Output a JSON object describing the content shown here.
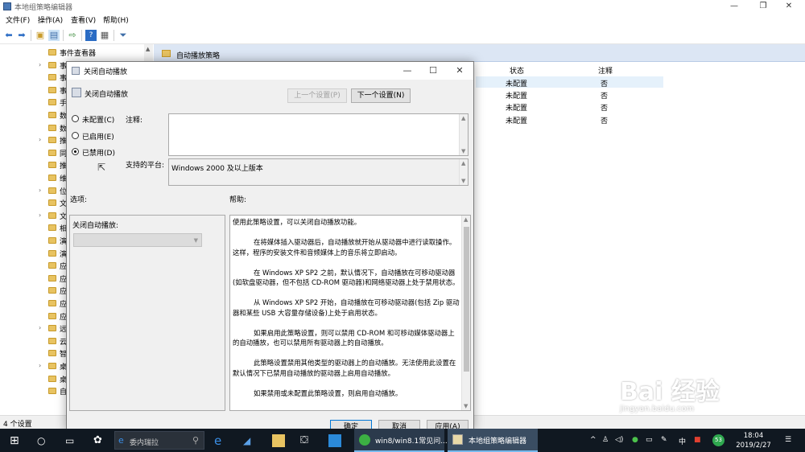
{
  "window": {
    "title": "本地组策略编辑器",
    "minimize": "—",
    "maximize": "❐",
    "close": "✕"
  },
  "menu": [
    "文件(F)",
    "操作(A)",
    "查看(V)",
    "帮助(H)"
  ],
  "tree": {
    "items": [
      {
        "label": "事件查看器",
        "expandable": false
      },
      {
        "label": "事",
        "expandable": true
      },
      {
        "label": "事",
        "expandable": false
      },
      {
        "label": "事",
        "expandable": false
      },
      {
        "label": "手",
        "expandable": false
      },
      {
        "label": "数",
        "expandable": false
      },
      {
        "label": "数",
        "expandable": false
      },
      {
        "label": "推",
        "expandable": true
      },
      {
        "label": "同",
        "expandable": false
      },
      {
        "label": "推",
        "expandable": false
      },
      {
        "label": "维",
        "expandable": false
      },
      {
        "label": "位",
        "expandable": true
      },
      {
        "label": "文",
        "expandable": false
      },
      {
        "label": "文",
        "expandable": true
      },
      {
        "label": "相",
        "expandable": false
      },
      {
        "label": "演",
        "expandable": false
      },
      {
        "label": "演",
        "expandable": false
      },
      {
        "label": "应",
        "expandable": false
      },
      {
        "label": "应",
        "expandable": false
      },
      {
        "label": "应",
        "expandable": false
      },
      {
        "label": "应",
        "expandable": false
      },
      {
        "label": "应",
        "expandable": false
      },
      {
        "label": "远",
        "expandable": true
      },
      {
        "label": "云",
        "expandable": false
      },
      {
        "label": "智",
        "expandable": false
      },
      {
        "label": "桌",
        "expandable": true
      },
      {
        "label": "桌",
        "expandable": false
      },
      {
        "label": "自",
        "expandable": false
      }
    ]
  },
  "right_pane": {
    "header": "自动播放策略",
    "columns": {
      "state": "状态",
      "note": "注释"
    },
    "rows": [
      {
        "state": "未配置",
        "note": "否"
      },
      {
        "state": "未配置",
        "note": "否"
      },
      {
        "state": "未配置",
        "note": "否"
      },
      {
        "state": "未配置",
        "note": "否"
      }
    ]
  },
  "status_bar": "4 个设置",
  "dialog": {
    "title": "关闭自动播放",
    "setting_name": "关闭自动播放",
    "prev_button": "上一个设置(P)",
    "next_button": "下一个设置(N)",
    "radio": {
      "not_configured": "未配置(C)",
      "enabled": "已启用(E)",
      "disabled": "已禁用(D)",
      "selected": "disabled"
    },
    "comment_label": "注释:",
    "comment_value": "",
    "platform_label": "支持的平台:",
    "platform_value": "Windows 2000 及以上版本",
    "options_label": "选项:",
    "help_label": "帮助:",
    "option_field_label": "关闭自动播放:",
    "option_field_value": "",
    "help_paragraphs": [
      "使用此策略设置，可以关闭自动播放功能。",
      "在将媒体插入驱动器后，自动播放就开始从驱动器中进行读取操作。这样，程序的安装文件和音频媒体上的音乐将立即启动。",
      "在 Windows XP SP2 之前，默认情况下，自动播放在可移动驱动器(如软盘驱动器，但不包括 CD-ROM 驱动器)和网络驱动器上处于禁用状态。",
      "从 Windows XP SP2 开始，自动播放在可移动驱动器(包括 Zip 驱动器和某些 USB 大容量存储设备)上处于启用状态。",
      "如果启用此策略设置，则可以禁用 CD-ROM 和可移动媒体驱动器上的自动播放，也可以禁用所有驱动器上的自动播放。",
      "此策略设置禁用其他类型的驱动器上的自动播放。无法使用此设置在默认情况下已禁用自动播放的驱动器上启用自动播放。",
      "如果禁用或未配置此策略设置，则启用自动播放。"
    ],
    "ok": "确定",
    "cancel": "取消",
    "apply": "应用(A)"
  },
  "taskbar": {
    "search_text": "委内瑞拉",
    "items": [
      {
        "label": "win8/win8.1常见问...",
        "active": false
      },
      {
        "label": "本地组策略编辑器",
        "active": true
      }
    ],
    "time": "18:04",
    "date": "2019/2/27",
    "ime": "中",
    "badge": "53"
  },
  "watermark": {
    "main": "Bai 经验",
    "sub": "jingyan.baidu.com"
  }
}
